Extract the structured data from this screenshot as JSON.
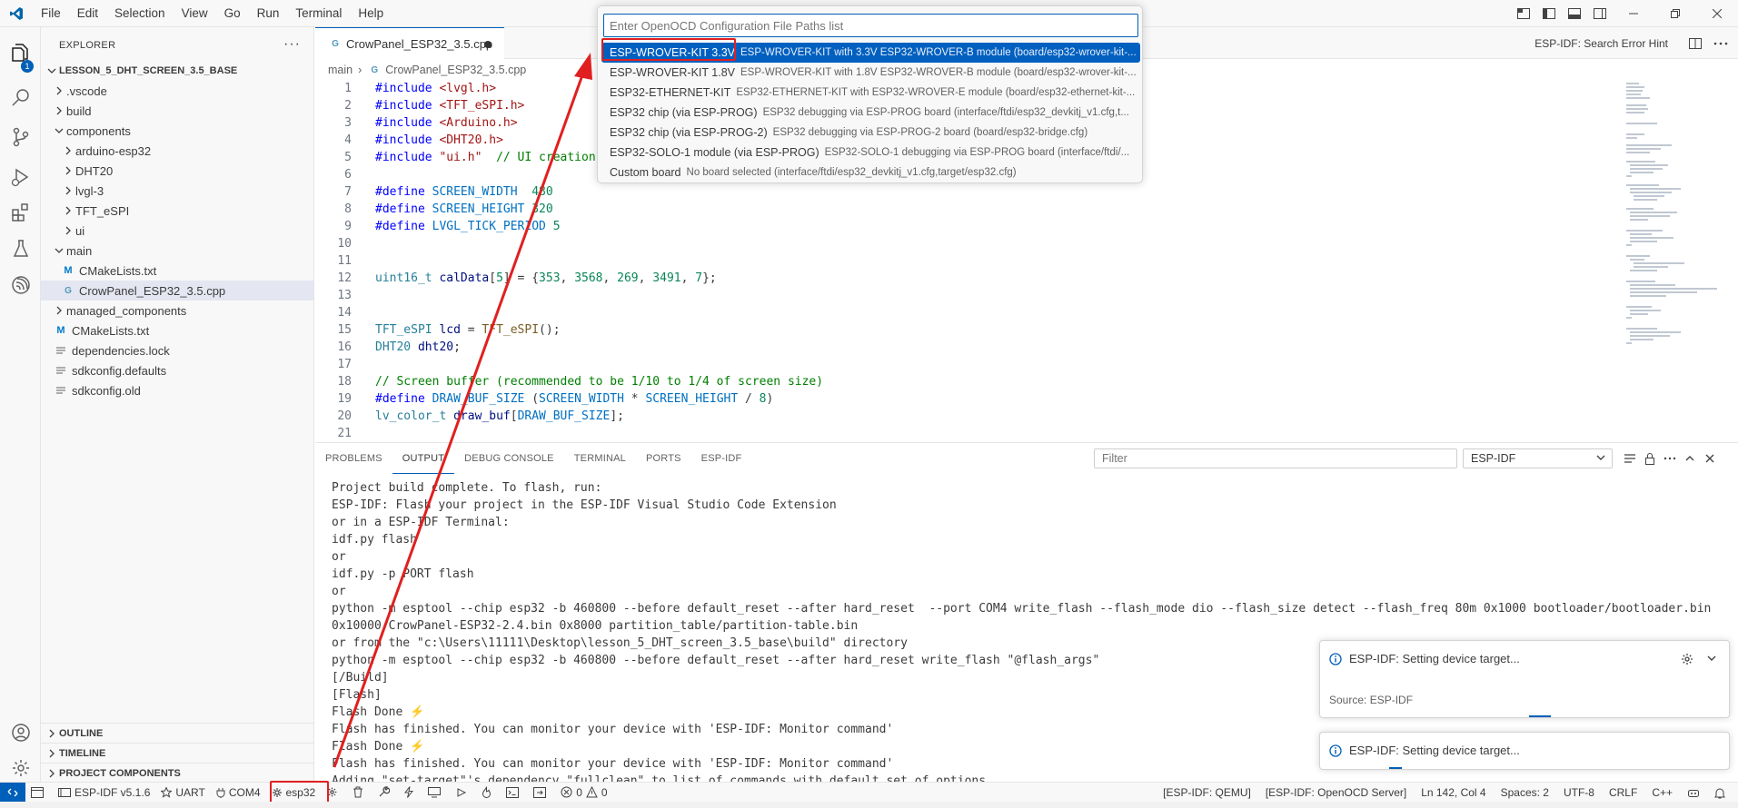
{
  "titlebar": {
    "menu": [
      "File",
      "Edit",
      "Selection",
      "View",
      "Go",
      "Run",
      "Terminal",
      "Help"
    ]
  },
  "explorer": {
    "header": "EXPLORER",
    "badge": "1",
    "root": "LESSON_5_DHT_SCREEN_3.5_BASE",
    "items": [
      {
        "label": ".vscode"
      },
      {
        "label": "build"
      },
      {
        "label": "components"
      },
      {
        "label": "arduino-esp32"
      },
      {
        "label": "DHT20"
      },
      {
        "label": "lvgl-3"
      },
      {
        "label": "TFT_eSPI"
      },
      {
        "label": "ui"
      },
      {
        "label": "main"
      },
      {
        "label": "CMakeLists.txt"
      },
      {
        "label": "CrowPanel_ESP32_3.5.cpp"
      },
      {
        "label": "managed_components"
      },
      {
        "label": "CMakeLists.txt"
      },
      {
        "label": "dependencies.lock"
      },
      {
        "label": "sdkconfig.defaults"
      },
      {
        "label": "sdkconfig.old"
      }
    ],
    "sections": [
      "OUTLINE",
      "TIMELINE",
      "PROJECT COMPONENTS"
    ]
  },
  "editor": {
    "tab_label": "CrowPanel_ESP32_3.5.cpp",
    "error_hint": "ESP-IDF: Search Error Hint",
    "breadcrumb": [
      "main",
      "CrowPanel_ESP32_3.5.cpp"
    ],
    "line_numbers": [
      "1",
      "2",
      "3",
      "4",
      "5",
      "6",
      "7",
      "8",
      "9",
      "10",
      "11",
      "12",
      "13",
      "14",
      "15",
      "16",
      "17",
      "18",
      "19",
      "20",
      "21"
    ]
  },
  "quickpick": {
    "placeholder": "Enter OpenOCD Configuration File Paths list",
    "items": [
      {
        "label": "ESP-WROVER-KIT 3.3V",
        "desc": "ESP-WROVER-KIT with 3.3V ESP32-WROVER-B module (board/esp32-wrover-kit-..."
      },
      {
        "label": "ESP-WROVER-KIT 1.8V",
        "desc": "ESP-WROVER-KIT with 1.8V ESP32-WROVER-B module (board/esp32-wrover-kit-..."
      },
      {
        "label": "ESP32-ETHERNET-KIT",
        "desc": "ESP32-ETHERNET-KIT with ESP32-WROVER-E module (board/esp32-ethernet-kit-..."
      },
      {
        "label": "ESP32 chip (via ESP-PROG)",
        "desc": "ESP32 debugging via ESP-PROG board (interface/ftdi/esp32_devkitj_v1.cfg,t..."
      },
      {
        "label": "ESP32 chip (via ESP-PROG-2)",
        "desc": "ESP32 debugging via ESP-PROG-2 board (board/esp32-bridge.cfg)"
      },
      {
        "label": "ESP32-SOLO-1 module (via ESP-PROG)",
        "desc": "ESP32-SOLO-1 debugging via ESP-PROG board (interface/ftdi/..."
      },
      {
        "label": "Custom board",
        "desc": "No board selected (interface/ftdi/esp32_devkitj_v1.cfg,target/esp32.cfg)"
      }
    ]
  },
  "panel": {
    "tabs": [
      "PROBLEMS",
      "OUTPUT",
      "DEBUG CONSOLE",
      "TERMINAL",
      "PORTS",
      "ESP-IDF"
    ],
    "filter_placeholder": "Filter",
    "channel": "ESP-IDF",
    "output": [
      "Project build complete. To flash, run:",
      "ESP-IDF: Flash your project in the ESP-IDF Visual Studio Code Extension",
      "or in a ESP-IDF Terminal:",
      "idf.py flash",
      "or",
      "idf.py -p PORT flash",
      "or",
      "python -m esptool --chip esp32 -b 460800 --before default_reset --after hard_reset  --port COM4 write_flash --flash_mode dio --flash_size detect --flash_freq 80m 0x1000 bootloader/bootloader.bin",
      "0x10000 CrowPanel-ESP32-2.4.bin 0x8000 partition_table/partition-table.bin",
      "or from the \"c:\\Users\\11111\\Desktop\\lesson_5_DHT_screen_3.5_base\\build\" directory",
      "python -m esptool --chip esp32 -b 460800 --before default_reset --after hard_reset write_flash \"@flash_args\"",
      "[/Build]",
      "[Flash]",
      "Flash Done ⚡️",
      "Flash has finished. You can monitor your device with 'ESP-IDF: Monitor command'",
      "Flash Done ⚡️",
      "Flash has finished. You can monitor your device with 'ESP-IDF: Monitor command'",
      "Adding \"set-target\"'s dependency \"fullclean\" to list of commands with default set of options."
    ]
  },
  "notifications": [
    {
      "message": "ESP-IDF: Setting device target...",
      "source": "Source: ESP-IDF"
    },
    {
      "message": "ESP-IDF: Setting device target..."
    }
  ],
  "statusbar": {
    "idf_version": "ESP-IDF v5.1.6",
    "uart": "UART",
    "port": "COM4",
    "target": "esp32",
    "errors": "0",
    "warnings": "0",
    "qemu": "[ESP-IDF: QEMU]",
    "openocd": "[ESP-IDF: OpenOCD Server]",
    "position": "Ln 142, Col 4",
    "spaces": "Spaces: 2",
    "encoding": "UTF-8",
    "eol": "CRLF",
    "language": "C++"
  },
  "colors": {
    "accent": "#005fb8",
    "annotation": "#e02020"
  }
}
